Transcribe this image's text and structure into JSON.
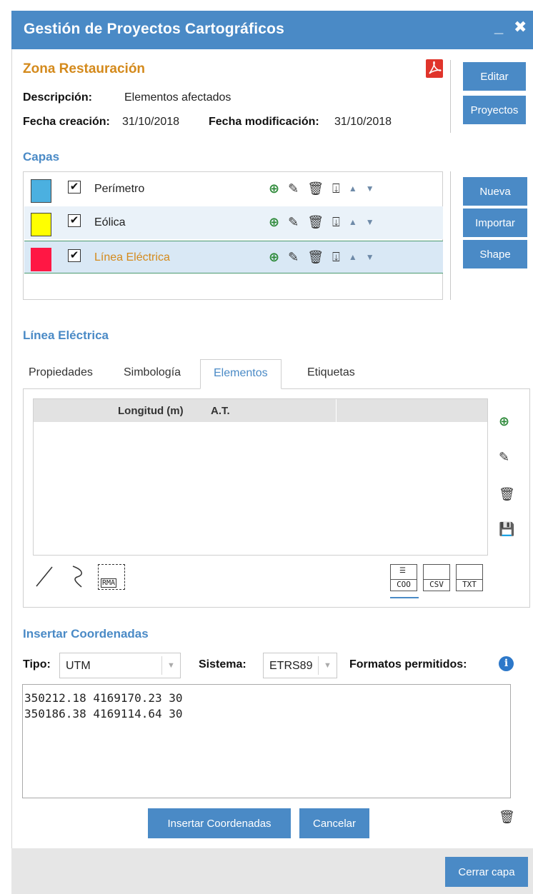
{
  "window": {
    "title": "Gestión de Proyectos Cartográficos",
    "minimize": "_",
    "close": "✖"
  },
  "project": {
    "name": "Zona Restauración",
    "description_label": "Descripción:",
    "description_value": "Elementos afectados",
    "created_label": "Fecha creación:",
    "created_value": "31/10/2018",
    "modified_label": "Fecha modificación:",
    "modified_value": "31/10/2018"
  },
  "project_buttons": {
    "edit": "Editar",
    "projects": "Proyectos"
  },
  "layers": {
    "heading": "Capas",
    "items": [
      {
        "name": "Perímetro",
        "color": "#4bb0e0",
        "checked": "✔",
        "selected": false
      },
      {
        "name": "Eólica",
        "color": "#ffff00",
        "checked": "✔",
        "selected": false
      },
      {
        "name": "Línea Eléctrica",
        "color": "#ff1744",
        "checked": "✔",
        "selected": true
      }
    ],
    "buttons": {
      "new": "Nueva",
      "import": "Importar",
      "shape": "Shape"
    }
  },
  "layer_detail": {
    "heading": "Línea Eléctrica",
    "tabs": [
      "Propiedades",
      "Simbología",
      "Elementos",
      "Etiquetas"
    ],
    "active_tab": "Elementos",
    "grid_columns": [
      "Longitud (m)",
      "A.T."
    ],
    "rma_label": "RMA",
    "file_formats": [
      "COO",
      "CSV",
      "TXT"
    ]
  },
  "insert_coords": {
    "heading": "Insertar Coordenadas",
    "type_label": "Tipo:",
    "type_value": "UTM",
    "system_label": "Sistema:",
    "system_value": "ETRS89",
    "formats_label": "Formatos permitidos:",
    "text": "350212.18 4169170.23 30\n350186.38 4169114.64 30",
    "insert_button": "Insertar Coordenadas",
    "cancel_button": "Cancelar"
  },
  "footer": {
    "close_layer": "Cerrar capa"
  },
  "colors": {
    "accent": "#4a8ac6",
    "orange": "#d48a1c",
    "selected_row": "#d9e8f5"
  }
}
